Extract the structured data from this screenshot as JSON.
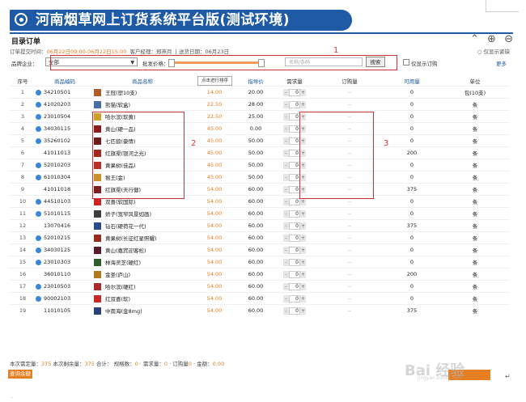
{
  "window": {
    "title": "河南烟草网上订货系统平台版(测试环境)"
  },
  "header": {
    "section_title": "目录订单",
    "icons": [
      "collapse-icon",
      "zoom-in-icon",
      "zoom-out-icon"
    ],
    "order_info": {
      "time_label": "订单提交时间：",
      "time_value": "06月22日09:00-06月22日15:00",
      "manager_label": "客户经理：",
      "manager_value": "郑燕月",
      "delivery_label": "送货日期：",
      "delivery_value": "06月23日"
    },
    "show_stock_label": "仅显示紧缺"
  },
  "filter": {
    "brand_label": "品牌企业：",
    "brand_value": "全部",
    "price_label": "批发价格：",
    "search_placeholder": "名称/条码",
    "search_button": "搜索",
    "only_order_label": "仅显示订购",
    "more_label": "更多",
    "tooltip": "点击进行排序"
  },
  "annotations": {
    "label_1": "1",
    "label_2": "2",
    "label_3": "3"
  },
  "table": {
    "columns": [
      "序号",
      "商品编码",
      "商品名称",
      "",
      "指导价",
      "需求量",
      "订购量",
      "可用量",
      "单位"
    ],
    "rows": [
      {
        "no": "1",
        "code": "34210501",
        "name": "王冠(塑10支)",
        "price": "14.00",
        "guide": "20.00",
        "qty": "0",
        "order": "--",
        "avail": "0",
        "unit": "包(10支)",
        "pack": "#b15a2a",
        "badge": true
      },
      {
        "no": "2",
        "code": "41020203",
        "name": "熊猫(软盒)",
        "price": "22.50",
        "guide": "28.00",
        "qty": "0",
        "order": "--",
        "avail": "0",
        "unit": "条",
        "pack": "#4a6fa5",
        "badge": true
      },
      {
        "no": "3",
        "code": "23010504",
        "name": "哈尔滨(软黄)",
        "price": "22.50",
        "guide": "25.00",
        "qty": "0",
        "order": "--",
        "avail": "0",
        "unit": "条",
        "pack": "#c9a227",
        "badge": true
      },
      {
        "no": "4",
        "code": "34030115",
        "name": "黄山(硬一品)",
        "price": "45.00",
        "guide": "0.00",
        "qty": "0",
        "order": "--",
        "avail": "0",
        "unit": "条",
        "pack": "#8e1c1c",
        "badge": true
      },
      {
        "no": "5",
        "code": "35260102",
        "name": "七匹狼(豪情)",
        "price": "45.00",
        "guide": "50.00",
        "qty": "0",
        "order": "--",
        "avail": "0",
        "unit": "条",
        "pack": "#6b1d1d",
        "badge": true
      },
      {
        "no": "6",
        "code": "41011013",
        "name": "红旗渠(银河之光)",
        "price": "45.00",
        "guide": "50.00",
        "qty": "0",
        "order": "--",
        "avail": "200",
        "unit": "条",
        "pack": "#a0281c",
        "badge": false
      },
      {
        "no": "7",
        "code": "52010203",
        "name": "黄果树(佳品)",
        "price": "45.00",
        "guide": "50.00",
        "qty": "0",
        "order": "--",
        "avail": "0",
        "unit": "条",
        "pack": "#b8302a",
        "badge": true
      },
      {
        "no": "8",
        "code": "61010304",
        "name": "猴王(金)",
        "price": "45.00",
        "guide": "50.00",
        "qty": "0",
        "order": "--",
        "avail": "0",
        "unit": "条",
        "pack": "#c8932a",
        "badge": true
      },
      {
        "no": "9",
        "code": "41011018",
        "name": "红旗渠(天行健)",
        "price": "54.00",
        "guide": "60.00",
        "qty": "0",
        "order": "--",
        "avail": "375",
        "unit": "条",
        "pack": "#7d2020",
        "badge": false
      },
      {
        "no": "10",
        "code": "44510103",
        "name": "双喜(软国际)",
        "price": "54.00",
        "guide": "60.00",
        "qty": "0",
        "order": "--",
        "avail": "0",
        "unit": "条",
        "pack": "#cc2222",
        "badge": true
      },
      {
        "no": "11",
        "code": "51010115",
        "name": "娇子(宽窄风景如画)",
        "price": "54.00",
        "guide": "60.00",
        "qty": "0",
        "order": "--",
        "avail": "0",
        "unit": "条",
        "pack": "#3d3d3d",
        "badge": true
      },
      {
        "no": "12",
        "code": "13070416",
        "name": "钻石(硬荷花一代)",
        "price": "54.00",
        "guide": "60.00",
        "qty": "0",
        "order": "--",
        "avail": "375",
        "unit": "条",
        "pack": "#2a4a8a",
        "badge": false
      },
      {
        "no": "13",
        "code": "52010215",
        "name": "黄果树(长征红星照耀)",
        "price": "54.00",
        "guide": "60.00",
        "qty": "0",
        "order": "--",
        "avail": "0",
        "unit": "条",
        "pack": "#9b2a1e",
        "badge": true
      },
      {
        "no": "14",
        "code": "34030125",
        "name": "黄山(嘉宾迎客松)",
        "price": "54.00",
        "guide": "60.00",
        "qty": "0",
        "order": "--",
        "avail": "0",
        "unit": "条",
        "pack": "#5a1a2a",
        "badge": true
      },
      {
        "no": "15",
        "code": "23010303",
        "name": "林海灵芝(硬红)",
        "price": "54.00",
        "guide": "60.00",
        "qty": "0",
        "order": "--",
        "avail": "0",
        "unit": "条",
        "pack": "#2f5d2f",
        "badge": true
      },
      {
        "no": "16",
        "code": "36010110",
        "name": "金圣(庐山)",
        "price": "54.00",
        "guide": "60.00",
        "qty": "0",
        "order": "--",
        "avail": "200",
        "unit": "条",
        "pack": "#b07a1e",
        "badge": false
      },
      {
        "no": "17",
        "code": "23010503",
        "name": "哈尔滨(硬红)",
        "price": "54.00",
        "guide": "60.00",
        "qty": "0",
        "order": "--",
        "avail": "0",
        "unit": "条",
        "pack": "#a82a2a",
        "badge": true
      },
      {
        "no": "18",
        "code": "90002103",
        "name": "红双喜(软)",
        "price": "54.00",
        "guide": "60.00",
        "qty": "0",
        "order": "--",
        "avail": "0",
        "unit": "条",
        "pack": "#c82828",
        "badge": true
      },
      {
        "no": "19",
        "code": "11010105",
        "name": "中南海(金8mg)",
        "price": "54.00",
        "guide": "60.00",
        "qty": "0",
        "order": "--",
        "avail": "375",
        "unit": "条",
        "pack": "#2b3f7a",
        "badge": false
      }
    ]
  },
  "footer": {
    "demand_label": "本次需定量：",
    "demand_value": "375",
    "remain_label": "本次剩余量：",
    "remain_value": "375",
    "total_label": "合计：",
    "kinds_label": "规格数：",
    "kinds_value": "0",
    "need_label": "需求量：",
    "need_value": "0",
    "order_label": "订购量",
    "order_value": "0",
    "amount_label": "金额：",
    "amount_value": "0.00",
    "query_button": "查询余额"
  },
  "watermark": {
    "text": "Bai 经验",
    "sub": "jingyan.baidu.com"
  },
  "accent": "#e67e22",
  "brand": "#1e5aa6"
}
